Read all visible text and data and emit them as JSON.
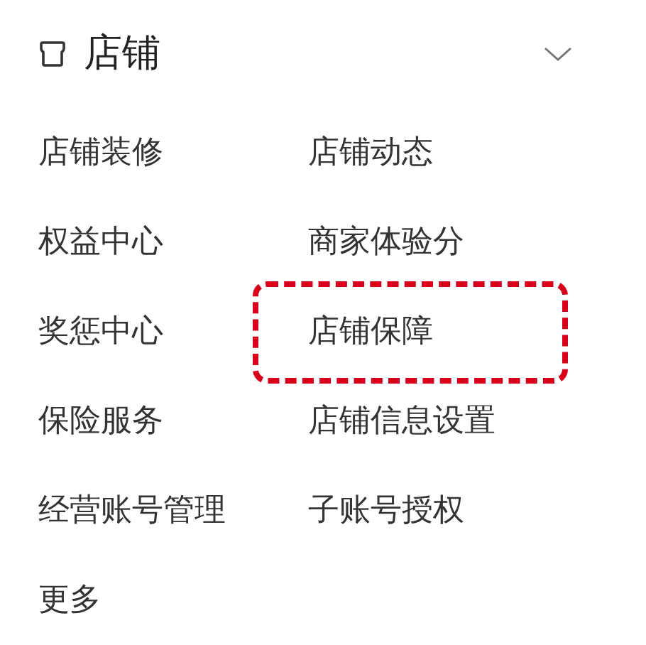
{
  "section": {
    "title": "店铺",
    "expanded": true
  },
  "items": [
    {
      "label": "店铺装修",
      "highlighted": false
    },
    {
      "label": "店铺动态",
      "highlighted": false
    },
    {
      "label": "权益中心",
      "highlighted": false
    },
    {
      "label": "商家体验分",
      "highlighted": false
    },
    {
      "label": "奖惩中心",
      "highlighted": false
    },
    {
      "label": "店铺保障",
      "highlighted": true
    },
    {
      "label": "保险服务",
      "highlighted": false
    },
    {
      "label": "店铺信息设置",
      "highlighted": false
    },
    {
      "label": "经营账号管理",
      "highlighted": false
    },
    {
      "label": "子账号授权",
      "highlighted": false
    },
    {
      "label": "更多",
      "highlighted": false
    }
  ]
}
